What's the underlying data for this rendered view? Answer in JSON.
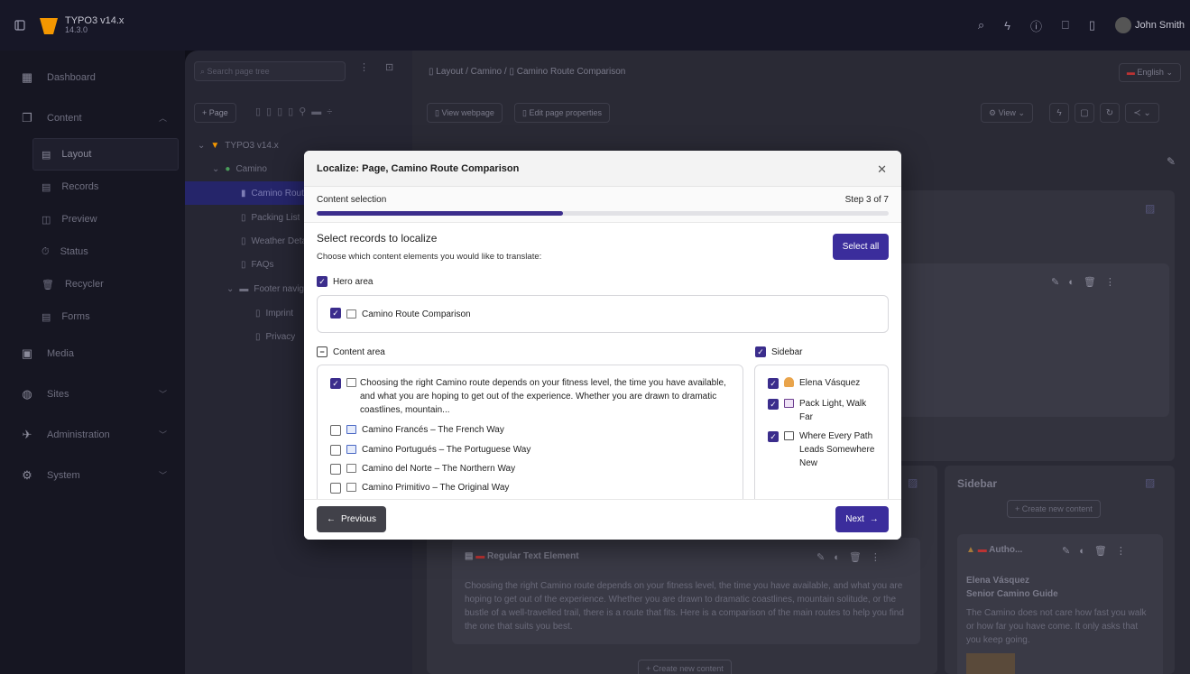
{
  "topbar": {
    "app_name": "TYPO3 v14.x",
    "app_version": "14.3.0",
    "user_name": "John Smith"
  },
  "sidebar": {
    "items": [
      {
        "label": "Dashboard",
        "icon": "dashboard-icon"
      },
      {
        "label": "Content",
        "icon": "content-icon"
      },
      {
        "label": "Layout",
        "icon": "layout-icon"
      },
      {
        "label": "Records",
        "icon": "records-icon"
      },
      {
        "label": "Preview",
        "icon": "preview-icon"
      },
      {
        "label": "Status",
        "icon": "status-icon"
      },
      {
        "label": "Recycler",
        "icon": "recycler-icon"
      },
      {
        "label": "Forms",
        "icon": "forms-icon"
      },
      {
        "label": "Media",
        "icon": "media-icon"
      },
      {
        "label": "Sites",
        "icon": "sites-icon"
      },
      {
        "label": "Administration",
        "icon": "administration-icon"
      },
      {
        "label": "System",
        "icon": "system-icon"
      }
    ]
  },
  "tree": {
    "search_placeholder": "Search page tree",
    "page_button": "Page",
    "nodes": [
      "TYPO3 v14.x",
      "Camino",
      "Camino Route Comparison",
      "Packing List",
      "Weather Details",
      "FAQs",
      "Footer navigation",
      "Imprint",
      "Privacy"
    ]
  },
  "main": {
    "breadcrumb": [
      "Layout",
      "Camino",
      "Camino Route Comparison"
    ],
    "language": "English",
    "view_webpage": "View webpage",
    "edit_page_properties": "Edit page properties",
    "view_label": "View",
    "sidebar_column_title": "Sidebar",
    "create_new_content": "Create new content",
    "regular_text_title": "Regular Text Element",
    "regular_text_body": "Choosing the right Camino route depends on your fitness level, the time you have available, and what you are hoping to get out of the experience. Whether you are drawn to dramatic coastlines, mountain solitude, or the bustle of a well-travelled trail, there is a route that fits. Here is a comparison of the main routes to help you find the one that suits you best.",
    "author_card_title": "Autho...",
    "author_name": "Elena Vásquez",
    "author_role": "Senior Camino Guide",
    "author_quote": "The Camino does not care how fast you walk or how far you have come. It only asks that you keep going."
  },
  "modal": {
    "title": "Localize: Page, Camino Route Comparison",
    "step_label": "Content selection",
    "step_counter": "Step 3 of 7",
    "progress": 0.43,
    "heading": "Select records to localize",
    "subheading": "Choose which content elements you would like to translate:",
    "select_all": "Select all",
    "hero_area": {
      "label": "Hero area",
      "items": [
        {
          "label": "Camino Route Comparison",
          "checked": true
        }
      ]
    },
    "content_area": {
      "label": "Content area",
      "items": [
        {
          "label": "Choosing the right Camino route depends on your fitness level, the time you have available, and what you are hoping to get out of the experience. Whether you are drawn to dramatic coastlines, mountain...",
          "checked": true
        },
        {
          "label": "Camino Francés – The French Way",
          "checked": false
        },
        {
          "label": "Camino Portugués – The Portuguese Way",
          "checked": false
        },
        {
          "label": "Camino del Norte – The Northern Way",
          "checked": false
        },
        {
          "label": "Camino Primitivo – The Original Way",
          "checked": false
        }
      ]
    },
    "sidebar_area": {
      "label": "Sidebar",
      "items": [
        {
          "label": "Elena Vásquez",
          "checked": true
        },
        {
          "label": "Pack Light, Walk Far",
          "checked": true
        },
        {
          "label": "Where Every Path Leads Somewhere New",
          "checked": true
        }
      ]
    },
    "previous": "Previous",
    "next": "Next"
  },
  "colors": {
    "accent": "#3b2d8c",
    "topbar": "#171727",
    "sidebar": "#161622"
  }
}
